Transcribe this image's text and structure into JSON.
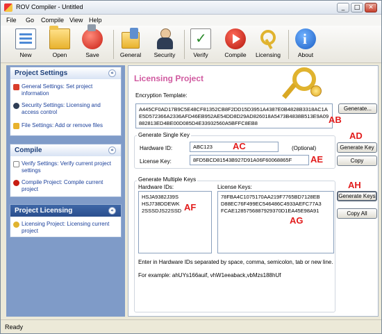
{
  "window": {
    "title": "ROV Compiler - Untitled",
    "min": "_",
    "max": "□",
    "close": "✕"
  },
  "menu": [
    "File",
    "Go",
    "Compile",
    "View",
    "Help"
  ],
  "toolbar": {
    "new": "New",
    "open": "Open",
    "save": "Save",
    "general": "General",
    "security": "Security",
    "verify": "Verify",
    "compile": "Compile",
    "licensing": "Licensing",
    "about": "About"
  },
  "sidebar": {
    "project_settings": {
      "title": "Project Settings",
      "items": [
        "General Settings: Set project information",
        "Security Settings: Licensing and access control",
        "File Settings: Add or remove files"
      ]
    },
    "compile": {
      "title": "Compile",
      "items": [
        "Verify Settings: Verify current project settings",
        "Compile Project: Compile current project"
      ]
    },
    "project_licensing": {
      "title": "Project Licensing",
      "items": [
        "Licensing Project: Licensing current project"
      ]
    },
    "chevron": "«"
  },
  "main": {
    "title": "Licensing Project",
    "encryption_template": {
      "label": "Encryption Template:",
      "value": "A445CF0AD17B9C5E48CF81352CB8F2DD15D3951A4387E0B4828B3318AC1AE5D572366A2336AFD46EB952AE54DD8D29AD826018A5473B4838B513E9A09882813ED4BE00D085D4E33932560A5BFFC8EB8",
      "generate_button": "Generate..."
    },
    "single_key": {
      "group_label": "Generate Single Key",
      "hardware_id_label": "Hardware ID:",
      "hardware_id_value": "ABC123",
      "optional_label": "(Optional)",
      "generate_key_button": "Generate Key",
      "license_key_label": "License Key:",
      "license_key_value": "8FD5BCD81543B927D91A06F60068865F",
      "copy_button": "Copy"
    },
    "multiple_keys": {
      "group_label": "Generate Multiple Keys",
      "hardware_ids_label": "Hardware IDs:",
      "hardware_ids": [
        "HSJA9382J39S",
        "HSJ738DDEWK",
        "2SSSDJS22SSD"
      ],
      "license_keys_label": "License Keys:",
      "license_keys": [
        "78FBA4C1075170AA219F7765BD7128EB",
        "D88EC76F499EC546486C4933AEFC77A3",
        "FCAE1285756887929370D1EA45E98A91"
      ],
      "generate_keys_button": "Generate Keys",
      "copy_all_button": "Copy All",
      "hint": "Enter in Hardware IDs separated by space, comma, semicolon, tab or new line.",
      "example": "For example: ahUYs166auif, vhW1eeaback,vbMzs188hUf"
    }
  },
  "annotations": {
    "ab": "AB",
    "ac": "AC",
    "ad": "AD",
    "ae": "AE",
    "af": "AF",
    "ag": "AG",
    "ah": "AH"
  },
  "status": "Ready"
}
